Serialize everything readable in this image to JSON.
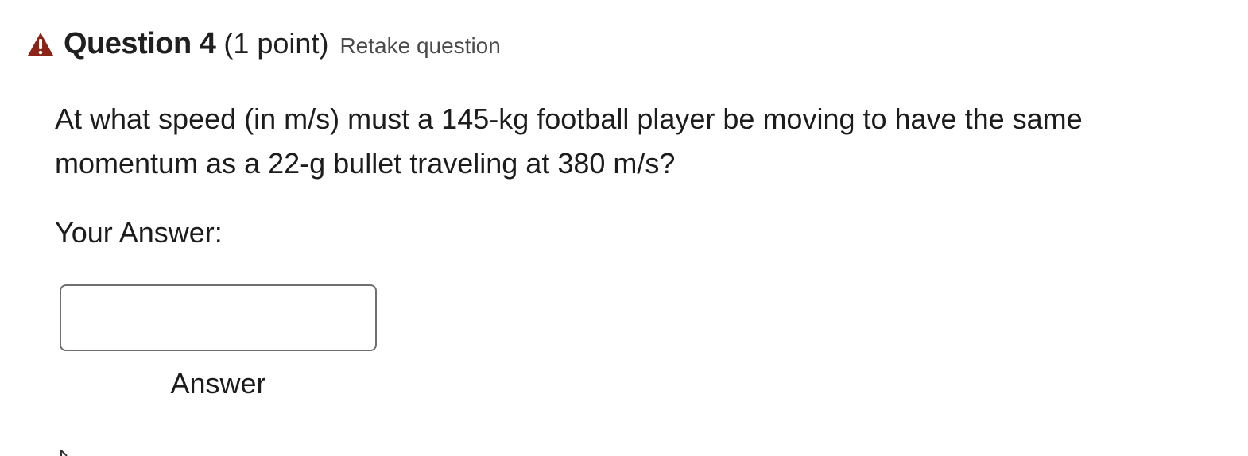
{
  "question": {
    "title": "Question 4",
    "points": "(1 point)",
    "retake_label": "Retake question",
    "status_icon": "warning-triangle-icon",
    "status_color": "#8b2417",
    "text": "At what speed (in m/s) must a 145-kg football player be moving to have the same momentum as a 22-g bullet traveling at 380 m/s?"
  },
  "answer": {
    "label": "Your Answer:",
    "value": "",
    "placeholder": "",
    "caption": "Answer"
  }
}
